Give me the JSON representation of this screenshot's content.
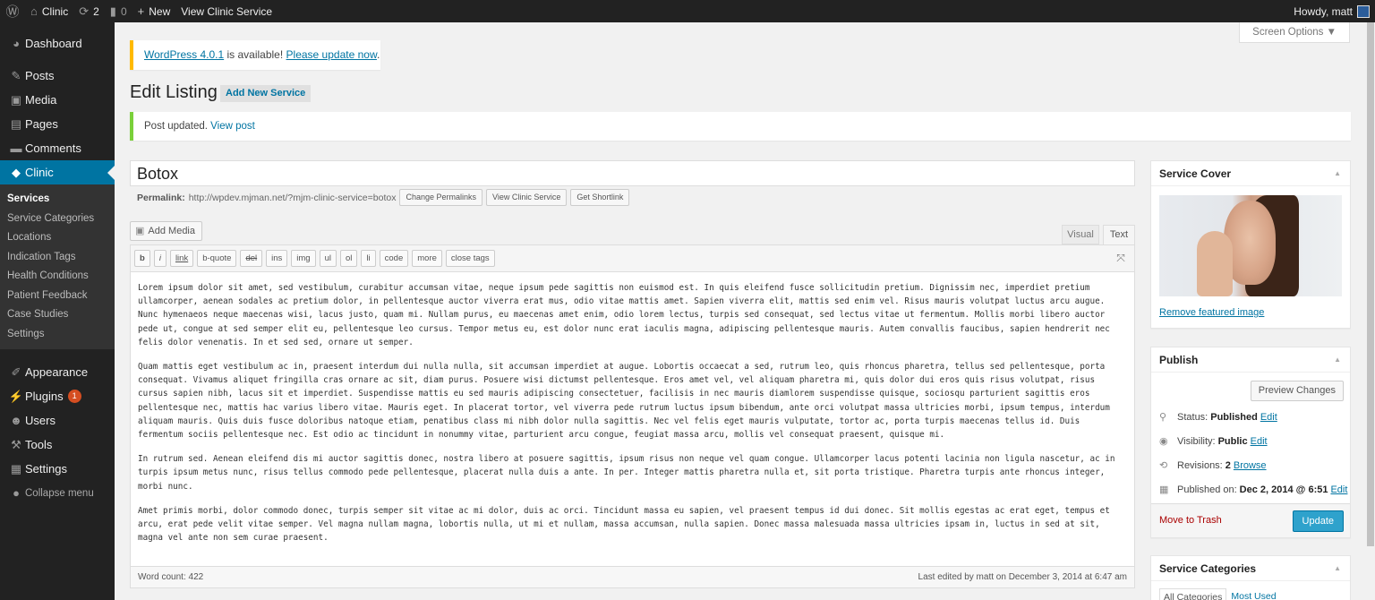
{
  "adminbar": {
    "wp_logo_icon": "wordpress-icon",
    "site_name": "Clinic",
    "updates_count": "2",
    "comments_count": "0",
    "new_label": "New",
    "view_label": "View Clinic Service",
    "howdy": "Howdy, matt"
  },
  "sidebar": {
    "items": [
      {
        "icon": "dashboard-icon",
        "label": "Dashboard"
      },
      {
        "icon": "pin-icon",
        "label": "Posts"
      },
      {
        "icon": "media-icon",
        "label": "Media"
      },
      {
        "icon": "pages-icon",
        "label": "Pages"
      },
      {
        "icon": "comments-icon",
        "label": "Comments"
      },
      {
        "icon": "clinic-icon",
        "label": "Clinic"
      }
    ],
    "submenu": [
      "Services",
      "Service Categories",
      "Locations",
      "Indication Tags",
      "Health Conditions",
      "Patient Feedback",
      "Case Studies",
      "Settings"
    ],
    "items2": [
      {
        "icon": "appearance-icon",
        "label": "Appearance"
      },
      {
        "icon": "plugins-icon",
        "label": "Plugins",
        "badge": "1"
      },
      {
        "icon": "users-icon",
        "label": "Users"
      },
      {
        "icon": "tools-icon",
        "label": "Tools"
      },
      {
        "icon": "settings-icon",
        "label": "Settings"
      },
      {
        "icon": "collapse-icon",
        "label": "Collapse menu"
      }
    ]
  },
  "screen_options": "Screen Options ▼",
  "update_notice": {
    "link1": "WordPress 4.0.1",
    "middle": " is available! ",
    "link2": "Please update now",
    "end": "."
  },
  "page_title": "Edit Listing",
  "add_new": "Add New Service",
  "updated_notice": {
    "text": "Post updated. ",
    "link": "View post"
  },
  "post": {
    "title": "Botox",
    "permalink_label": "Permalink:",
    "permalink_url": "http://wpdev.mjman.net/?mjm-clinic-service=botox",
    "buttons": [
      "Change Permalinks",
      "View Clinic Service",
      "Get Shortlink"
    ]
  },
  "editor": {
    "add_media": "Add Media",
    "tab_visual": "Visual",
    "tab_text": "Text",
    "quicktags": [
      "b",
      "i",
      "link",
      "b-quote",
      "del",
      "ins",
      "img",
      "ul",
      "ol",
      "li",
      "code",
      "more",
      "close tags"
    ],
    "paragraphs": [
      "Lorem ipsum dolor sit amet, sed vestibulum, curabitur accumsan vitae, neque ipsum pede sagittis non euismod est. In quis eleifend fusce sollicitudin pretium. Dignissim nec, imperdiet pretium ullamcorper, aenean sodales ac pretium dolor, in pellentesque auctor viverra erat mus, odio vitae mattis amet. Sapien viverra elit, mattis sed enim vel. Risus mauris volutpat luctus arcu augue. Nunc hymenaeos neque maecenas wisi, lacus justo, quam mi. Nullam purus, eu maecenas amet enim, odio lorem lectus, turpis sed consequat, sed lectus vitae ut fermentum. Mollis morbi libero auctor pede ut, congue at sed semper elit eu, pellentesque leo cursus. Tempor metus eu, est dolor nunc erat iaculis magna, adipiscing pellentesque mauris. Autem convallis faucibus, sapien hendrerit nec felis dolor venenatis. In et sed sed, ornare ut semper.",
      "Quam mattis eget vestibulum ac in, praesent interdum dui nulla nulla, sit accumsan imperdiet at augue. Lobortis occaecat a sed, rutrum leo, quis rhoncus pharetra, tellus sed pellentesque, porta consequat. Vivamus aliquet fringilla cras ornare ac sit, diam purus. Posuere wisi dictumst pellentesque. Eros amet vel, vel aliquam pharetra mi, quis dolor dui eros quis risus volutpat, risus cursus sapien nibh, lacus sit et imperdiet. Suspendisse mattis eu sed mauris adipiscing consectetuer, facilisis in nec mauris diamlorem suspendisse quisque, sociosqu parturient sagittis eros pellentesque nec, mattis hac varius libero vitae. Mauris eget. In placerat tortor, vel viverra pede rutrum luctus ipsum bibendum, ante orci volutpat massa ultricies morbi, ipsum tempus, interdum aliquam mauris. Quis duis fusce doloribus natoque etiam, penatibus class mi nibh dolor nulla sagittis. Nec vel felis eget mauris vulputate, tortor ac, porta turpis maecenas tellus id. Duis fermentum sociis pellentesque nec. Est odio ac tincidunt in nonummy vitae, parturient arcu congue, feugiat massa arcu, mollis vel consequat praesent, quisque mi.",
      "In rutrum sed. Aenean eleifend dis mi auctor sagittis donec, nostra libero at posuere sagittis, ipsum risus non neque vel quam congue. Ullamcorper lacus potenti lacinia non ligula nascetur, ac in turpis ipsum metus nunc, risus tellus commodo pede pellentesque, placerat nulla duis a ante. In per. Integer mattis pharetra nulla et, sit porta tristique. Pharetra turpis ante rhoncus integer, morbi nunc.",
      "Amet primis morbi, dolor commodo donec, turpis semper sit vitae ac mi dolor, duis ac orci. Tincidunt massa eu sapien, vel praesent tempus id dui donec. Sit mollis egestas ac erat eget, tempus et arcu, erat pede velit vitae semper. Vel magna nullam magna, lobortis nulla, ut mi et nullam, massa accumsan, nulla sapien. Donec massa malesuada massa ultricies ipsam in, luctus in sed at sit, magna vel ante non sem curae praesent."
    ],
    "word_count": "Word count: 422",
    "last_edited": "Last edited by matt on December 3, 2014 at 6:47 am"
  },
  "service_cover": {
    "title": "Service Cover",
    "remove": "Remove featured image"
  },
  "publish": {
    "title": "Publish",
    "preview": "Preview Changes",
    "status_label": "Status:",
    "status_value": "Published",
    "visibility_label": "Visibility:",
    "visibility_value": "Public",
    "revisions_label": "Revisions:",
    "revisions_value": "2",
    "browse": "Browse",
    "published_label": "Published on:",
    "published_value": "Dec 2, 2014 @ 6:51",
    "edit": "Edit",
    "trash": "Move to Trash",
    "update": "Update"
  },
  "service_categories": {
    "title": "Service Categories",
    "tab_all": "All Categories",
    "tab_most": "Most Used"
  },
  "colors": {
    "admin_bar": "#222222",
    "active_menu": "#0074a2",
    "update_button": "#2ea2cc"
  }
}
